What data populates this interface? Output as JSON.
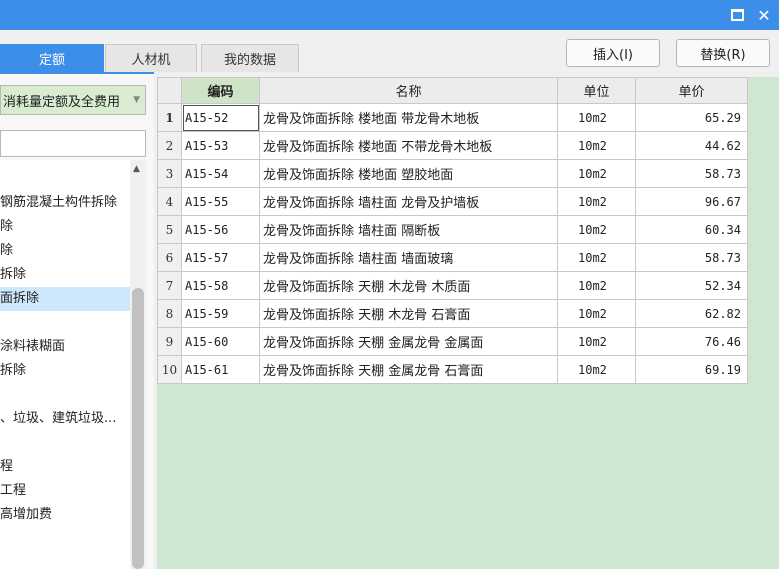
{
  "window": {
    "max_label": "□",
    "close_label": "✕"
  },
  "tabs": [
    {
      "label": "定额",
      "active": true
    },
    {
      "label": "人材机",
      "active": false
    },
    {
      "label": "我的数据",
      "active": false
    }
  ],
  "toolbar": {
    "insert_label": "插入(I)",
    "replace_label": "替换(R)"
  },
  "left": {
    "selector_text": "消耗量定额及全费用",
    "filter_value": "",
    "tree_items": [
      "",
      "钢筋混凝土构件拆除",
      "除",
      "除",
      "拆除",
      "面拆除",
      "",
      "涂料裱糊面",
      "拆除",
      "",
      "、垃圾、建筑垃圾...",
      "",
      "程",
      "工程",
      "高增加费"
    ],
    "selected_index": 5
  },
  "grid": {
    "columns": [
      "",
      "编码",
      "名称",
      "单位",
      "单价"
    ],
    "rows": [
      {
        "num": "1",
        "code": "A15-52",
        "name": "龙骨及饰面拆除 楼地面 带龙骨木地板",
        "unit": "10m2",
        "price": "65.29"
      },
      {
        "num": "2",
        "code": "A15-53",
        "name": "龙骨及饰面拆除 楼地面 不带龙骨木地板",
        "unit": "10m2",
        "price": "44.62"
      },
      {
        "num": "3",
        "code": "A15-54",
        "name": "龙骨及饰面拆除 楼地面 塑胶地面",
        "unit": "10m2",
        "price": "58.73"
      },
      {
        "num": "4",
        "code": "A15-55",
        "name": "龙骨及饰面拆除 墙柱面 龙骨及护墙板",
        "unit": "10m2",
        "price": "96.67"
      },
      {
        "num": "5",
        "code": "A15-56",
        "name": "龙骨及饰面拆除 墙柱面 隔断板",
        "unit": "10m2",
        "price": "60.34"
      },
      {
        "num": "6",
        "code": "A15-57",
        "name": "龙骨及饰面拆除 墙柱面 墙面玻璃",
        "unit": "10m2",
        "price": "58.73"
      },
      {
        "num": "7",
        "code": "A15-58",
        "name": "龙骨及饰面拆除 天棚 木龙骨 木质面",
        "unit": "10m2",
        "price": "52.34"
      },
      {
        "num": "8",
        "code": "A15-59",
        "name": "龙骨及饰面拆除 天棚 木龙骨 石膏面",
        "unit": "10m2",
        "price": "62.82"
      },
      {
        "num": "9",
        "code": "A15-60",
        "name": "龙骨及饰面拆除 天棚 金属龙骨 金属面",
        "unit": "10m2",
        "price": "76.46"
      },
      {
        "num": "10",
        "code": "A15-61",
        "name": "龙骨及饰面拆除 天棚 金属龙骨 石膏面",
        "unit": "10m2",
        "price": "69.19"
      }
    ]
  },
  "colors": {
    "titlebar": "#3d8ee8",
    "active_tab": "#3d8ee8",
    "grid_empty_area": "#cfe6d0",
    "selector_bg": "#d7ecd0",
    "selected_tree_item": "#cde8fb"
  }
}
